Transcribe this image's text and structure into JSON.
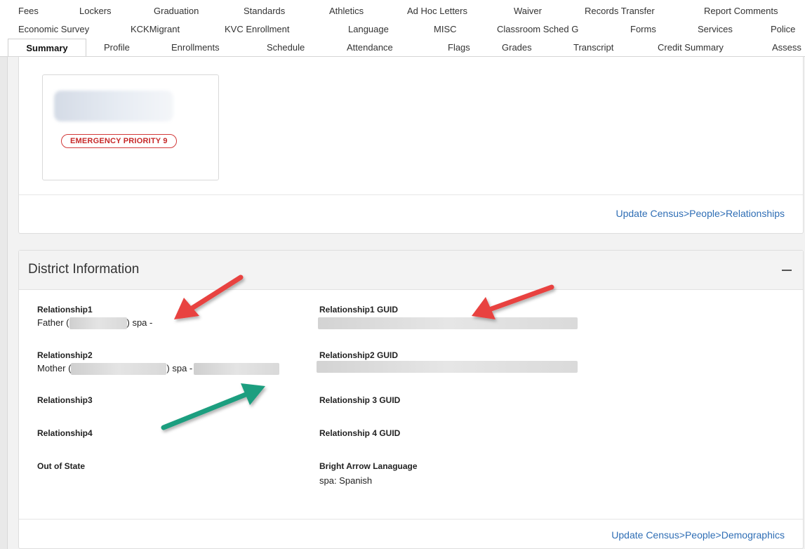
{
  "tabs": {
    "row1": [
      "Fees",
      "Lockers",
      "Graduation",
      "Standards",
      "Athletics",
      "Ad Hoc Letters",
      "Waiver",
      "Records Transfer",
      "Report Comments"
    ],
    "row2": [
      "Economic Survey",
      "KCKMigrant",
      "KVC Enrollment",
      "Language",
      "MISC",
      "Classroom Sched G",
      "Forms",
      "Services",
      "Police"
    ],
    "row3": [
      "Summary",
      "Profile",
      "Enrollments",
      "Schedule",
      "Attendance",
      "Flags",
      "Grades",
      "Transcript",
      "Credit Summary",
      "Assess"
    ],
    "active": "Summary"
  },
  "relationships_card": {
    "badge": "EMERGENCY PRIORITY 9",
    "footer_link": "Update Census>People>Relationships"
  },
  "district_card": {
    "title": "District Information",
    "collapse_symbol": "−",
    "fields": {
      "relationship1": {
        "label": "Relationship1",
        "value_prefix": "Father (",
        "value_suffix": ") spa -"
      },
      "relationship1_guid": {
        "label": "Relationship1 GUID"
      },
      "relationship2": {
        "label": "Relationship2",
        "value_prefix": "Mother (",
        "value_suffix": ") spa -"
      },
      "relationship2_guid": {
        "label": "Relationship2 GUID"
      },
      "relationship3": {
        "label": "Relationship3"
      },
      "relationship3_guid": {
        "label": "Relationship 3 GUID"
      },
      "relationship4": {
        "label": "Relationship4"
      },
      "relationship4_guid": {
        "label": "Relationship 4 GUID"
      },
      "out_of_state": {
        "label": "Out of State"
      },
      "bright_arrow_language": {
        "label": "Bright Arrow Lanaguage",
        "value": "spa: Spanish"
      }
    },
    "footer_link": "Update Census>People>Demographics"
  },
  "annotation_colors": {
    "red_arrow": "#e8423f",
    "green_arrow": "#1f9e7f"
  },
  "colors": {
    "link": "#2f6eb5",
    "badge": "#c62828"
  }
}
